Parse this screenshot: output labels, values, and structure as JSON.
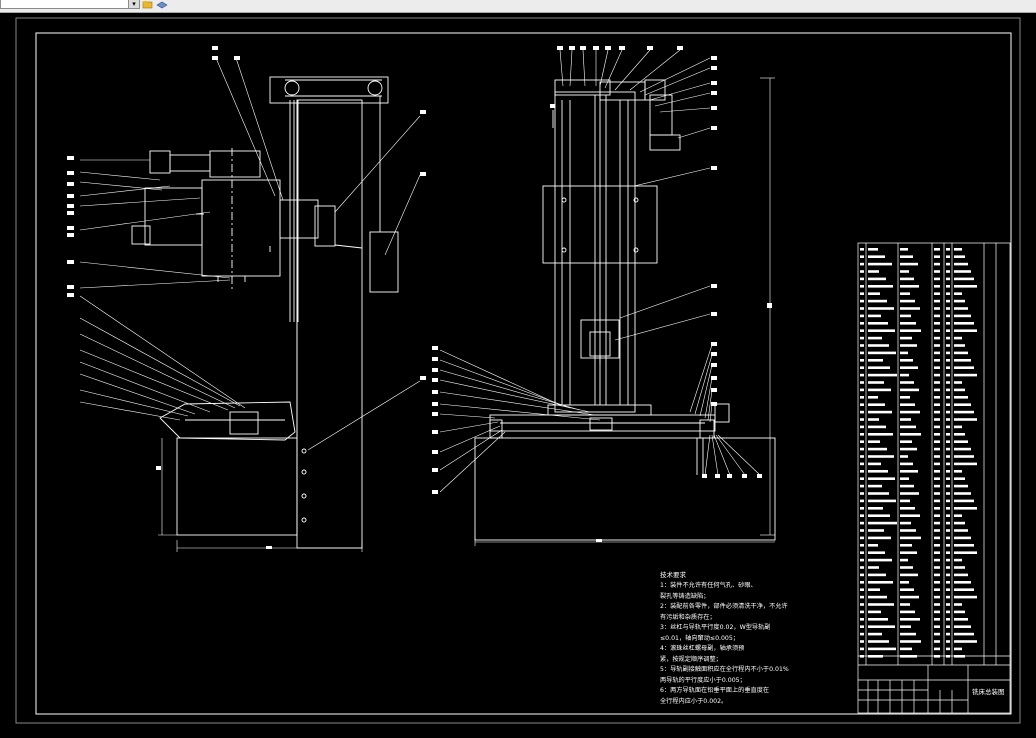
{
  "toolbar": {
    "icons": [
      "folder-icon",
      "layers-icon"
    ],
    "dropdown_glyph": "▾"
  },
  "technical_requirements": {
    "heading": "技术要求",
    "lines": [
      "1：装件不允许有任何气孔、砂眼、",
      "裂孔等铸造缺陷；",
      "2：装配前各零件，部件必须清洗干净，不允许",
      "有污垢和杂质存在；",
      "3：丝杠与导轨平行度0.02，W型导轨副",
      "≤0.01，轴向窜动≤0.005；",
      "4：滚珠丝杠螺母副，轴承须预",
      "紧，按规定顺序调整；",
      "5：导轨副接触面积应在全行程内不小于0.01%",
      "两导轨的平行度应小于0.005；",
      "6：两方导轨面在铅垂平面上的垂直度在",
      "全行程内应小于0.002。"
    ]
  },
  "title_block": {
    "drawing_name": "铣床总装图"
  },
  "colors": {
    "background": "#000000",
    "line": "#ffffff",
    "toolbar": "#ececec"
  }
}
